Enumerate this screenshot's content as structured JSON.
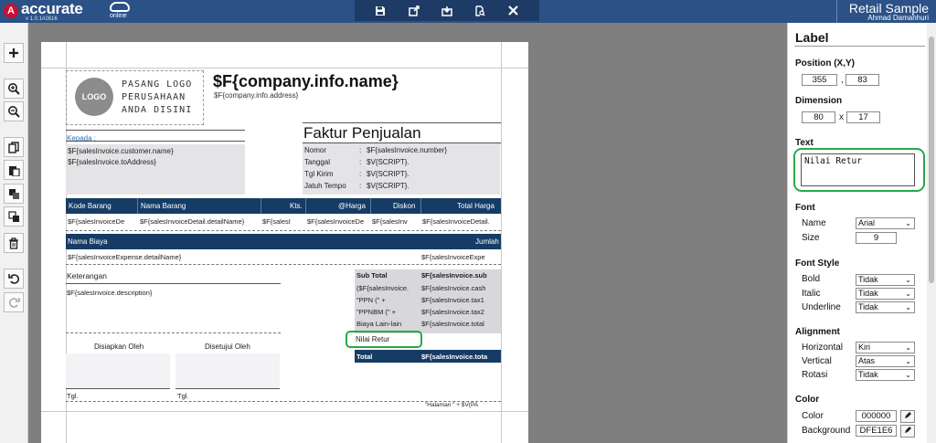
{
  "app": {
    "brand": "accurate",
    "brand_suffix": "online",
    "version": "v 1.0.1#2616",
    "name": "Retail Sample",
    "user": "Ahmad Damanhuri"
  },
  "toolbar": {
    "icons": [
      "save-icon",
      "export-icon",
      "import-icon",
      "preview-document-icon",
      "close-icon"
    ]
  },
  "leftbar": {
    "icons": [
      "add-icon",
      "zoom-in-icon",
      "zoom-out-icon",
      "copy-icon",
      "paste-icon",
      "bring-front-icon",
      "send-back-icon",
      "delete-icon",
      "undo-icon",
      "redo-icon"
    ]
  },
  "report": {
    "logo_circle": "LOGO",
    "logo_text_1": "PASANG LOGO",
    "logo_text_2": "PERUSAHAAN",
    "logo_text_3": "ANDA DISINI",
    "company_name": "$F{company.info.name}",
    "company_address": "$F{company.info.address}",
    "kepada": "Kepada :",
    "customer_name": "$F{salesInvoice.customer.name}",
    "to_address": "$F{salesInvoice.toAddress}",
    "title": "Faktur Penjualan",
    "info": [
      {
        "label": "Nomor",
        "value": "$F{salesInvoice.number}"
      },
      {
        "label": "Tanggal",
        "value": "$V{SCRIPT}."
      },
      {
        "label": "Tgl Kirim",
        "value": "$V{SCRIPT}."
      },
      {
        "label": "Jatuh Tempo",
        "value": "$V{SCRIPT}."
      }
    ],
    "detail_headers": [
      "Kode Barang",
      "Nama Barang",
      "Kts.",
      "@Harga",
      "Diskon",
      "Total Harga"
    ],
    "detail_cells": [
      "$F{salesInvoiceDe",
      "$F{salesInvoiceDetail.detailName}",
      "$F{salesI",
      "$F{salesInvoiceDe",
      "$F{salesInv",
      "$F{salesInvoiceDetail."
    ],
    "expense_headers": [
      "Nama Biaya",
      "Jumlah"
    ],
    "expense_cells": [
      "$F{salesInvoiceExpense.detailName}",
      "$F{salesInvoiceExpe"
    ],
    "keterangan": "Keterangan",
    "description": "$F{salesInvoice.description}",
    "disiapkan": "Disiapkan Oleh",
    "disetujui": "Disetujui Oleh",
    "tgl_1": "Tgl.",
    "tgl_2": "Tgl.",
    "footer_page": "\"Halaman \" + $V{PA",
    "summary": [
      {
        "label": "Sub Total",
        "value": "$F{salesInvoice.sub",
        "bold": true
      },
      {
        "label": "($F{salesInvoice.",
        "value": "$F{salesInvoice.cash"
      },
      {
        "label": "\"PPN (\" +",
        "value": "$F{salesInvoice.tax1"
      },
      {
        "label": "\"PPNBM (\" +",
        "value": "$F{salesInvoice.tax2"
      },
      {
        "label": "Biaya Lain-lain",
        "value": "$F{salesInvoice.total"
      }
    ],
    "nilai_retur": "Nilai Retur",
    "total_label": "Total",
    "total_value": "$F{salesInvoice.tota"
  },
  "panel": {
    "title": "Label",
    "position_label": "Position (X,Y)",
    "pos_x": "355",
    "pos_y": "83",
    "pos_sep": ",",
    "dimension_label": "Dimension",
    "dim_w": "80",
    "dim_h": "17",
    "dim_sep": "x",
    "text_label": "Text",
    "text_value": "Nilai Retur",
    "font_label": "Font",
    "font_name_label": "Name",
    "font_name": "Arial",
    "font_size_label": "Size",
    "font_size": "9",
    "font_style_label": "Font Style",
    "bold_label": "Bold",
    "bold": "Tidak",
    "italic_label": "Italic",
    "italic": "Tidak",
    "underline_label": "Underline",
    "underline": "Tidak",
    "alignment_label": "Alignment",
    "horizontal_label": "Horizontal",
    "horizontal": "Kiri",
    "vertical_label": "Vertical",
    "vertical": "Atas",
    "rotasi_label": "Rotasi",
    "rotasi": "Tidak",
    "color_label": "Color",
    "color_lbl": "Color",
    "color_value": "000000",
    "background_label": "Background",
    "background_value": "DFE1E6"
  },
  "colors": {
    "topbar": "#2b5187",
    "table_header": "#163c66",
    "highlight": "#2aa84a",
    "field_bg": "#e4e4e7"
  }
}
